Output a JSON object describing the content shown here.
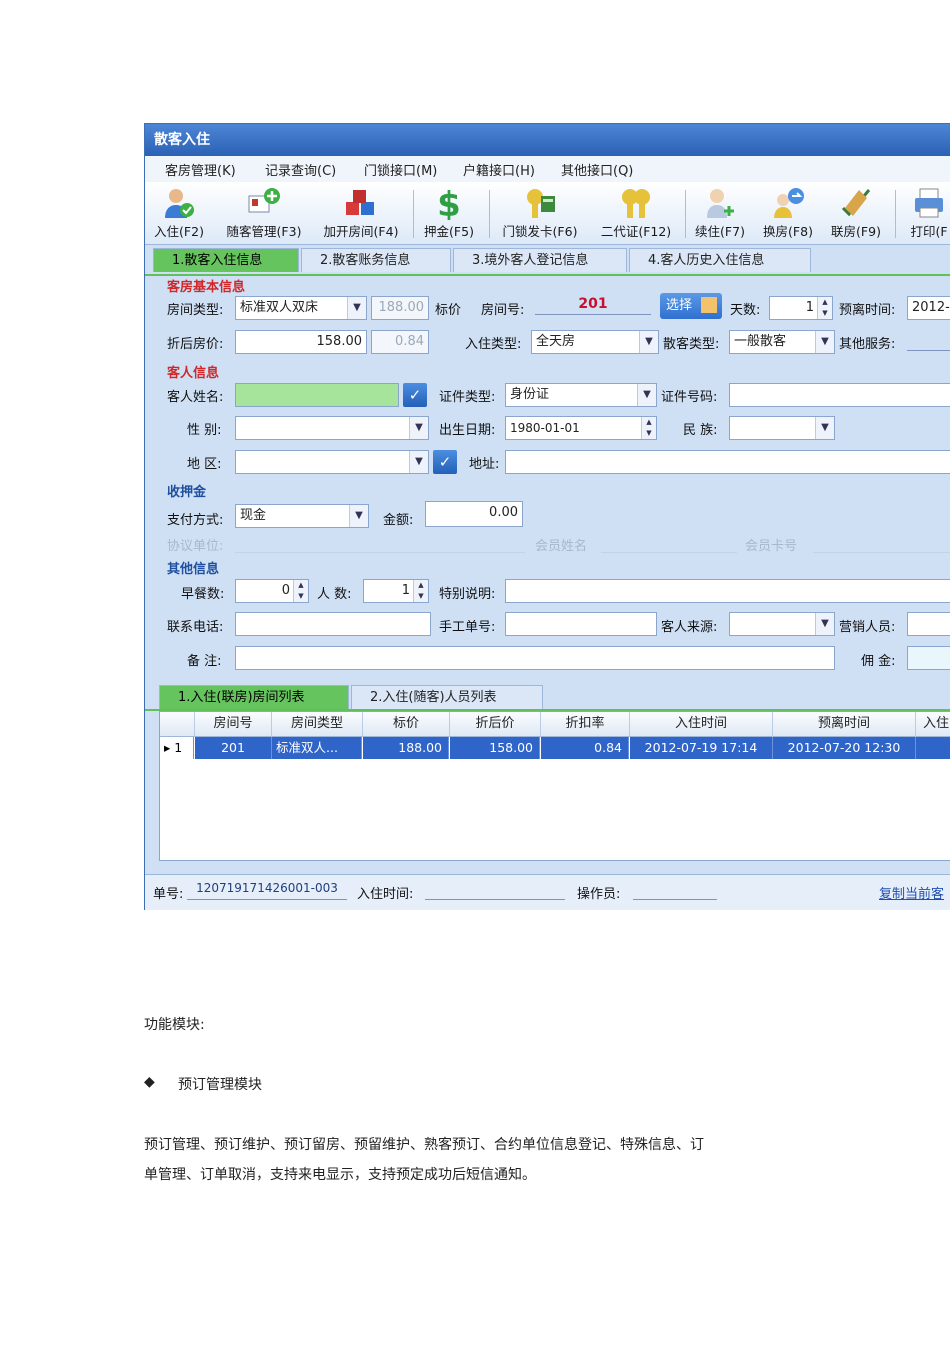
{
  "window": {
    "title": "散客入住"
  },
  "menu": [
    "客房管理(K)",
    "记录查询(C)",
    "门锁接口(M)",
    "户籍接口(H)",
    "其他接口(Q)"
  ],
  "toolbar": [
    "入住(F2)",
    "随客管理(F3)",
    "加开房间(F4)",
    "押金(F5)",
    "门锁发卡(F6)",
    "二代证(F12)",
    "续住(F7)",
    "换房(F8)",
    "联房(F9)",
    "打印(F"
  ],
  "tabs": [
    "1.散客入住信息",
    "2.散客账务信息",
    "3.境外客人登记信息",
    "4.客人历史入住信息"
  ],
  "room": {
    "section": "客房基本信息",
    "type_label": "房间类型:",
    "type_value": "标准双人双床",
    "list_price": "188.00",
    "list_price_label": "标价",
    "room_no_label": "房间号:",
    "room_no": "201",
    "select_btn": "选择",
    "days_label": "天数:",
    "days": "1",
    "depart_label": "预离时间:",
    "depart_value": "2012-",
    "discount_label": "折后房价:",
    "discount_price": "158.00",
    "discount_rate": "0.84",
    "stay_type_label": "入住类型:",
    "stay_type": "全天房",
    "guest_type_label": "散客类型:",
    "guest_type": "一般散客",
    "other_service_label": "其他服务:"
  },
  "guest": {
    "section": "客人信息",
    "name_label": "客人姓名:",
    "id_type_label": "证件类型:",
    "id_type": "身份证",
    "id_no_label": "证件号码:",
    "gender_label": "性  别:",
    "birth_label": "出生日期:",
    "birth": "1980-01-01",
    "nation_label": "民  族:",
    "region_label": "地  区:",
    "address_label": "地址:"
  },
  "deposit": {
    "section": "收押金",
    "pay_label": "支付方式:",
    "pay_value": "现金",
    "amount_label": "金额:",
    "amount": "0.00",
    "agreement_label": "协议单位:",
    "member_name_label": "会员姓名",
    "member_card_label": "会员卡号"
  },
  "other": {
    "section": "其他信息",
    "breakfast_label": "早餐数:",
    "breakfast": "0",
    "people_label": "人  数:",
    "people": "1",
    "special_label": "特别说明:",
    "phone_label": "联系电话:",
    "manual_label": "手工单号:",
    "source_label": "客人来源:",
    "sales_label": "营销人员:",
    "remark_label": "备  注:",
    "commission_label": "佣  金:"
  },
  "grid_tabs": [
    "1.入住(联房)房间列表",
    "2.入住(随客)人员列表"
  ],
  "grid": {
    "columns": [
      "房间号",
      "房间类型",
      "标价",
      "折后价",
      "折扣率",
      "入住时间",
      "预离时间",
      "入住"
    ],
    "rows": [
      {
        "marker": "▸ 1",
        "room": "201",
        "type": "标准双人...",
        "price": "188.00",
        "discount_price": "158.00",
        "rate": "0.84",
        "checkin": "2012-07-19 17:14",
        "depart": "2012-07-20 12:30"
      }
    ]
  },
  "status": {
    "order_label": "单号:",
    "order_no": "120719171426001-003",
    "checkin_label": "入住时间:",
    "operator_label": "操作员:",
    "copy_link": "复制当前客"
  },
  "doc": {
    "heading": "功能模块:",
    "bullet_mark": "◆",
    "bullet_title": "预订管理模块",
    "para_line1": "预订管理、预订维护、预订留房、预留维护、熟客预订、合约单位信息登记、特殊信息、订",
    "para_line2": "单管理、订单取消，支持来电显示，支持预定成功后短信通知。"
  },
  "colors": {
    "title_bar": "#2a61b4",
    "tab_active": "#66c45e",
    "section_red": "#d02828",
    "section_blue": "#1f4f9e",
    "row_selected": "#2f64c9",
    "room_no": "#c8102e"
  }
}
